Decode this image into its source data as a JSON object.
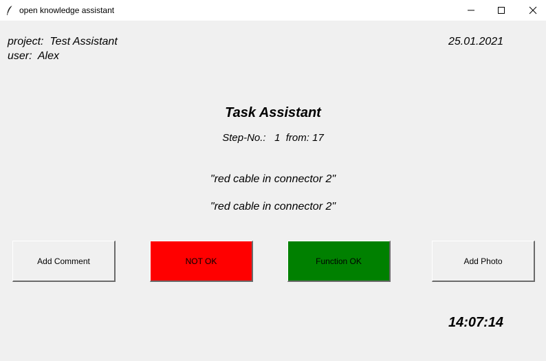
{
  "window": {
    "title": "open knowledge assistant",
    "icon": "feather-icon"
  },
  "info": {
    "project": "project:  Test Assistant",
    "user": "user:  Alex",
    "date": "25.01.2021"
  },
  "main": {
    "heading": "Task Assistant",
    "step": "Step-No.:   1  from: 17",
    "description_1": "\"red cable in connector 2\"",
    "description_2": "\"red cable in connector 2\""
  },
  "buttons": {
    "add_comment": "Add Comment",
    "not_ok": "NOT OK",
    "function_ok": "Function OK",
    "add_photo": "Add Photo"
  },
  "colors": {
    "not_ok": "#ff0000",
    "function_ok": "#008000",
    "background": "#f0f0f0"
  },
  "clock": "14:07:14"
}
